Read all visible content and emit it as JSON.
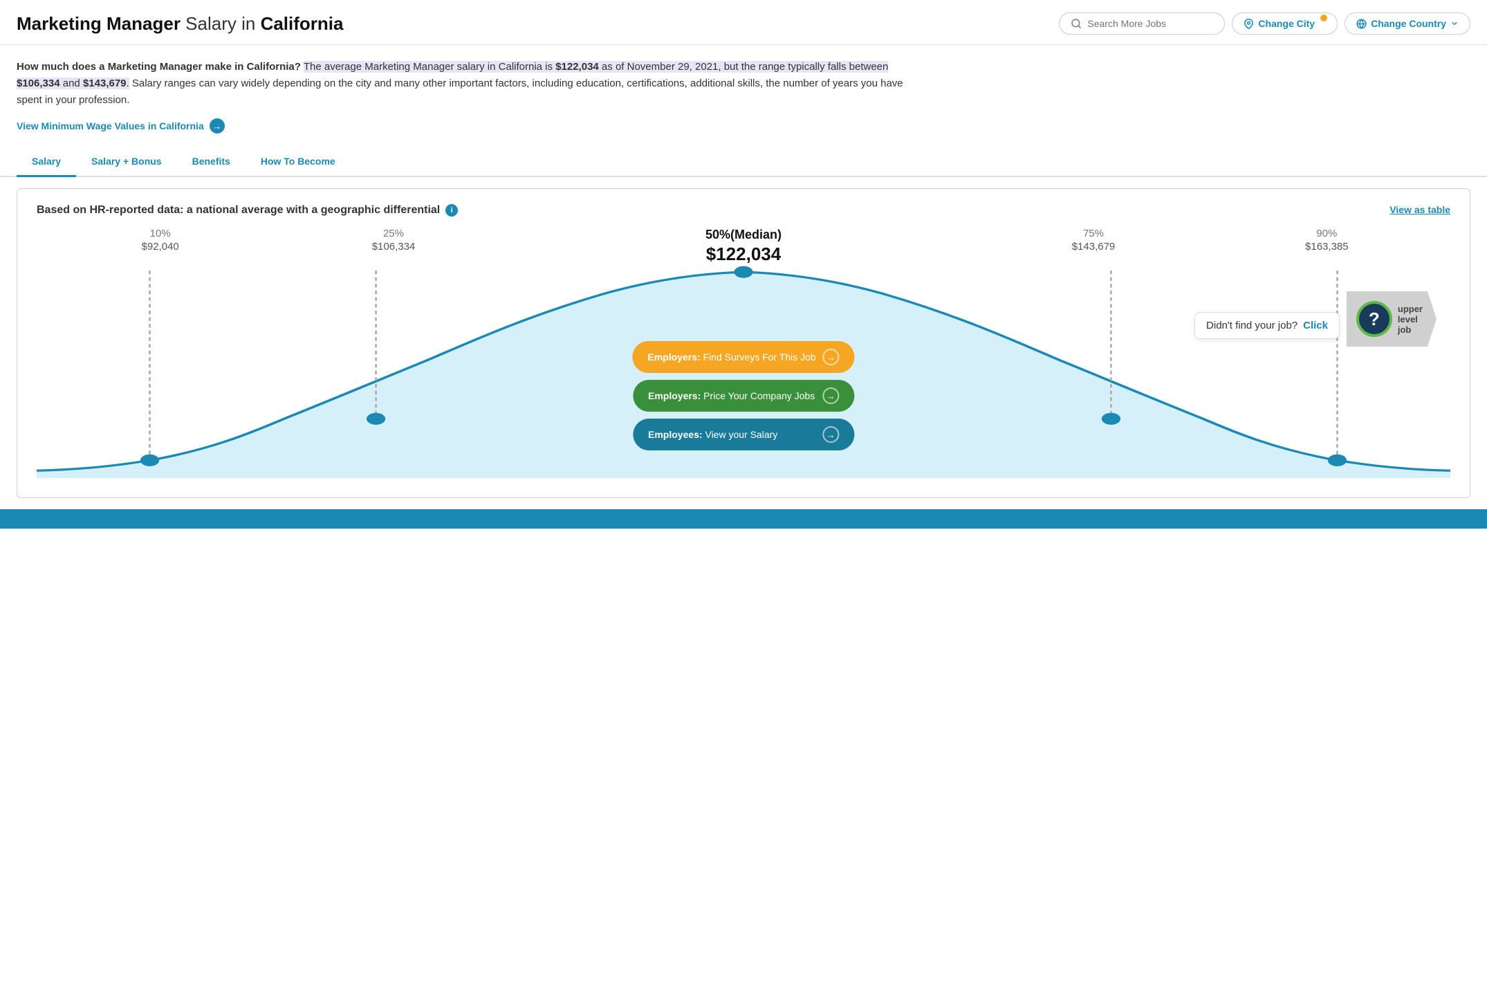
{
  "header": {
    "title_regular": "Marketing Manager",
    "title_suffix": " Salary in ",
    "title_location": "California",
    "search_placeholder": "Search More Jobs",
    "change_city_label": "Change City",
    "change_country_label": "Change Country",
    "has_city_dot": true
  },
  "description": {
    "question": "How much does a Marketing Manager make in California?",
    "intro": " The average Marketing Manager salary in California is ",
    "avg_salary": "$122,034",
    "date_text": " as of November 29, 2021, but the range typically falls between ",
    "low_salary": "$106,334",
    "and_text": " and ",
    "high_salary": "$143,679",
    "suffix_text": ". Salary ranges can vary widely depending on the city and many other important factors, including education, certifications, additional skills, the number of years you have spent in your profession.",
    "min_wage_link": "View Minimum Wage Values in California"
  },
  "tabs": [
    {
      "label": "Salary",
      "active": true
    },
    {
      "label": "Salary + Bonus",
      "active": false
    },
    {
      "label": "Benefits",
      "active": false
    },
    {
      "label": "How To Become",
      "active": false
    }
  ],
  "chart": {
    "title": "Based on HR-reported data: a national average with a geographic differential",
    "view_table_label": "View as table",
    "percentiles": [
      {
        "pct": "10%",
        "value": "$92,040",
        "bold": false,
        "x_ratio": 0.08
      },
      {
        "pct": "25%",
        "value": "$106,334",
        "bold": false,
        "x_ratio": 0.24
      },
      {
        "pct": "50%(Median)",
        "value": "$122,034",
        "bold": true,
        "x_ratio": 0.5
      },
      {
        "pct": "75%",
        "value": "$143,679",
        "bold": false,
        "x_ratio": 0.76
      },
      {
        "pct": "90%",
        "value": "$163,385",
        "bold": false,
        "x_ratio": 0.92
      }
    ],
    "didnt_find": {
      "text": "Didn't find your job?",
      "link_text": "Click"
    },
    "upper_level": {
      "line1": "upper",
      "line2": "level",
      "line3": "job"
    },
    "cta_buttons": [
      {
        "label_strong": "Employers:",
        "label_rest": " Find Surveys For This Job",
        "type": "orange"
      },
      {
        "label_strong": "Employers:",
        "label_rest": " Price Your Company Jobs",
        "type": "green"
      },
      {
        "label_strong": "Employees:",
        "label_rest": " View your Salary",
        "type": "teal"
      }
    ]
  },
  "colors": {
    "accent": "#1a8ab5",
    "orange": "#f5a623",
    "green": "#3a8f3a",
    "teal": "#1a7a9a",
    "highlight_bg": "#e8e4f5"
  }
}
